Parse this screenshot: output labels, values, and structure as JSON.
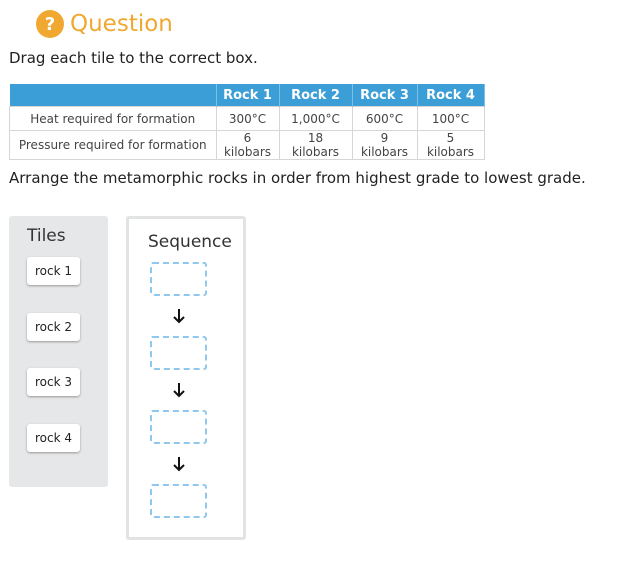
{
  "header": {
    "icon": "question-icon",
    "icon_glyph": "?",
    "title": "Question",
    "accent": "#f0a830"
  },
  "instruction": "Drag each tile to the correct box.",
  "table": {
    "columns": [
      "",
      "Rock 1",
      "Rock 2",
      "Rock 3",
      "Rock 4"
    ],
    "rows": [
      {
        "label": "Heat required for formation",
        "values": [
          "300°C",
          "1,000°C",
          "600°C",
          "100°C"
        ]
      },
      {
        "label": "Pressure required for formation",
        "values": [
          "6 kilobars",
          "18 kilobars",
          "9 kilobars",
          "5 kilobars"
        ]
      }
    ],
    "header_color": "#3c9ed6"
  },
  "prompt": "Arrange the metamorphic rocks in order from highest grade to lowest grade.",
  "tiles_panel": {
    "title": "Tiles",
    "tiles": [
      "rock 1",
      "rock 2",
      "rock 3",
      "rock 4"
    ]
  },
  "sequence_panel": {
    "title": "Sequence",
    "slot_count": 4,
    "arrow_icon": "arrow-down-icon"
  }
}
